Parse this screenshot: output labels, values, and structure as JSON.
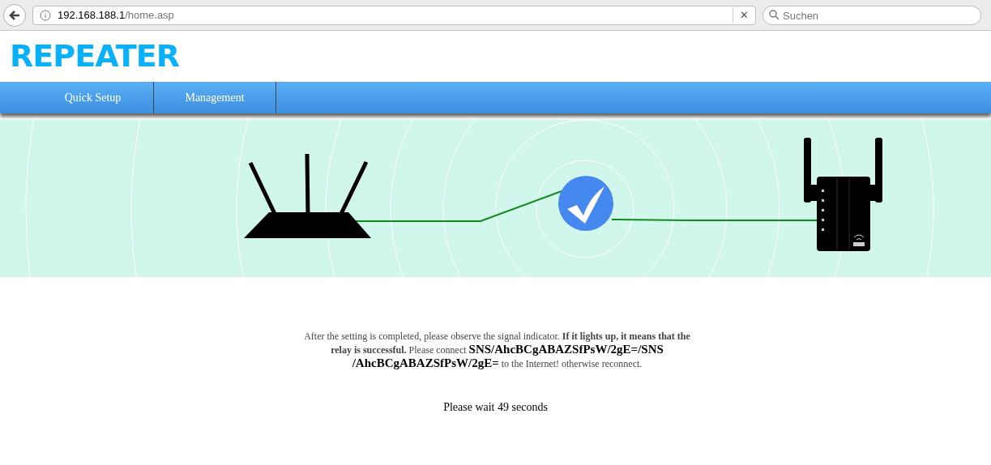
{
  "browser": {
    "url_host": "192.168.188.1",
    "url_path": "/home.asp",
    "search_placeholder": "Suchen",
    "clear_label": "✕"
  },
  "logo": "REPEATER",
  "nav": [
    {
      "label": "Quick Setup",
      "selected": false
    },
    {
      "label": "Management",
      "selected": false
    }
  ],
  "message": [
    {
      "kind": "normal",
      "text": "After the setting is completed, please observe the signal indicator. "
    },
    {
      "kind": "strong",
      "text": "If it lights up, it means that the relay is successful."
    },
    {
      "kind": "normal",
      "text": " Please connect "
    },
    {
      "kind": "ssid",
      "text": "SNS/AhcBCgABAZSfPsW/2gE=/SNS /AhcBCgABAZSfPsW/2gE="
    },
    {
      "kind": "normal",
      "text": " to the Internet! otherwise reconnect."
    }
  ],
  "countdown": "Please wait 49 seconds"
}
